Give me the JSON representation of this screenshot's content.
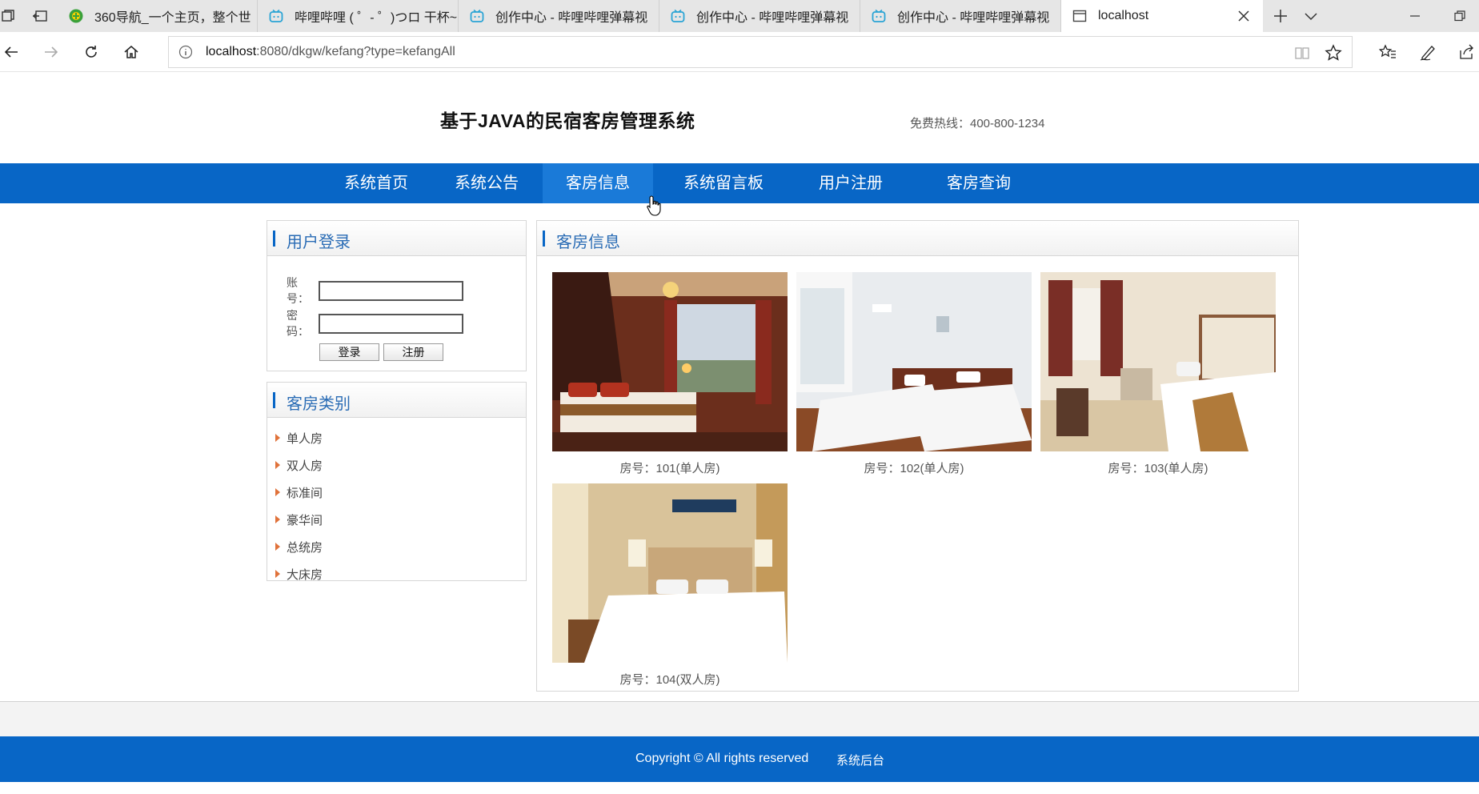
{
  "browser": {
    "tabs": [
      {
        "title": "360导航_一个主页，整个世"
      },
      {
        "title": "哔哩哔哩 ( ゜- ゜)つロ 干杯~"
      },
      {
        "title": "创作中心 - 哔哩哔哩弹幕视"
      },
      {
        "title": "创作中心 - 哔哩哔哩弹幕视"
      },
      {
        "title": "创作中心 - 哔哩哔哩弹幕视"
      },
      {
        "title": "localhost"
      }
    ],
    "url_host": "localhost",
    "url_rest": ":8080/dkgw/kefang?type=kefangAll"
  },
  "header": {
    "site_title": "基于JAVA的民宿客房管理系统",
    "hotline": "免费热线：400-800-1234"
  },
  "nav": {
    "items": [
      "系统首页",
      "系统公告",
      "客房信息",
      "系统留言板",
      "用户注册",
      "客房查询"
    ],
    "active_index": 2
  },
  "login": {
    "title": "用户登录",
    "account_label": "账号：",
    "password_label": "密码：",
    "account_value": "",
    "password_value": "",
    "login_button": "登录",
    "register_button": "注册"
  },
  "categories": {
    "title": "客房类别",
    "items": [
      "单人房",
      "双人房",
      "标准间",
      "豪华间",
      "总统房",
      "大床房"
    ]
  },
  "rooms": {
    "title": "客房信息",
    "items": [
      {
        "caption": "房号：101(单人房)"
      },
      {
        "caption": "房号：102(单人房)"
      },
      {
        "caption": "房号：103(单人房)"
      },
      {
        "caption": "房号：104(双人房)"
      }
    ]
  },
  "footer": {
    "copyright": "Copyright © All rights reserved",
    "admin_link": "系统后台"
  },
  "colors": {
    "nav_blue": "#0866c6",
    "nav_active": "#1a7ad8",
    "panel_title": "#2a6cb5",
    "category_arrow": "#e0723a"
  }
}
